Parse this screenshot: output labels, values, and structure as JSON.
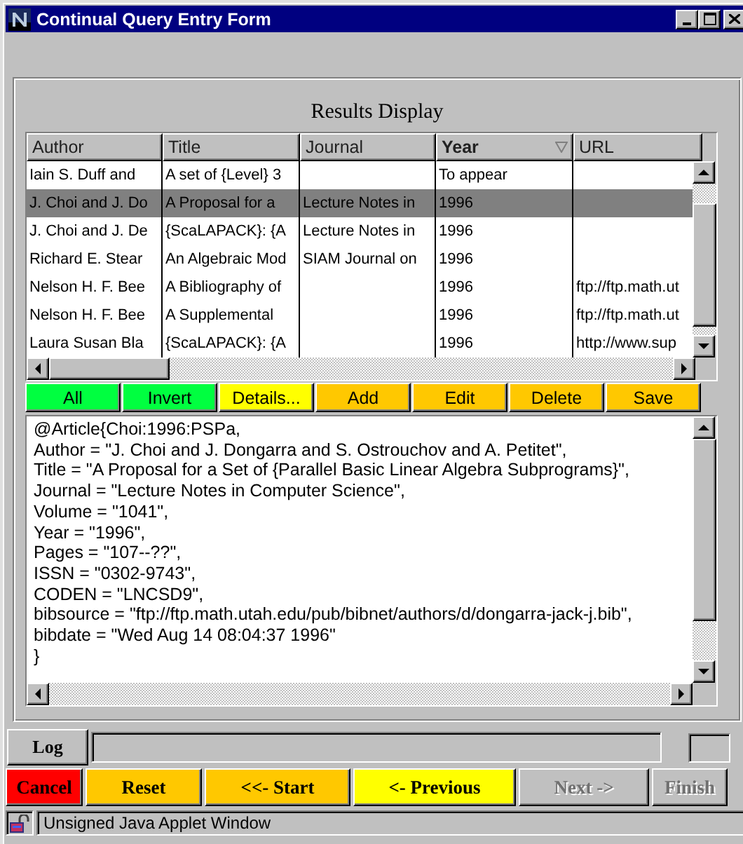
{
  "window": {
    "title": "Continual Query Entry Form"
  },
  "results": {
    "title": "Results Display",
    "columns": [
      {
        "label": "Author",
        "sorted": false
      },
      {
        "label": "Title",
        "sorted": false
      },
      {
        "label": "Journal",
        "sorted": false
      },
      {
        "label": "Year",
        "sorted": true
      },
      {
        "label": "URL",
        "sorted": false
      }
    ],
    "rows": [
      {
        "selected": false,
        "author": "Iain S. Duff and",
        "title": "A set of {Level} 3",
        "year": "To appear"
      },
      {
        "selected": true,
        "author": "J. Choi and J. Do",
        "title": "A Proposal for a",
        "journal": "Lecture Notes in",
        "year": "1996"
      },
      {
        "selected": false,
        "author": "J. Choi and J. De",
        "title": "{ScaLAPACK}: {A",
        "journal": "Lecture Notes in",
        "year": "1996"
      },
      {
        "selected": false,
        "author": "Richard E. Stear",
        "title": "An Algebraic Mod",
        "journal": "SIAM Journal on",
        "year": "1996"
      },
      {
        "selected": false,
        "author": "Nelson H. F. Bee",
        "title": "A Bibliography of",
        "year": "1996",
        "url": "ftp://ftp.math.ut"
      },
      {
        "selected": false,
        "author": "Nelson H. F. Bee",
        "title": "A Supplemental",
        "year": "1996",
        "url": "ftp://ftp.math.ut"
      },
      {
        "selected": false,
        "author": "Laura Susan Bla",
        "title": "{ScaLAPACK}: {A",
        "year": "1996",
        "url": "http://www.sup"
      }
    ],
    "buttons": [
      {
        "label": "All",
        "color": "#00ff40"
      },
      {
        "label": "Invert",
        "color": "#00ff40"
      },
      {
        "label": "Details...",
        "color": "#ffff00"
      },
      {
        "label": "Add",
        "color": "#ffc800"
      },
      {
        "label": "Edit",
        "color": "#ffc800"
      },
      {
        "label": "Delete",
        "color": "#ffc800"
      },
      {
        "label": "Save",
        "color": "#ffc800"
      }
    ],
    "details": [
      "@Article{Choi:1996:PSPa,",
      "Author = \"J. Choi and J. Dongarra and S. Ostrouchov and A. Petitet\",",
      "Title = \"A Proposal for a Set of {Parallel Basic Linear Algebra Subprograms}\",",
      "Journal = \"Lecture Notes in Computer Science\",",
      "Volume = \"1041\",",
      "Year = \"1996\",",
      "Pages = \"107--??\",",
      "ISSN = \"0302-9743\",",
      "CODEN = \"LNCSD9\",",
      "bibsource = \"ftp://ftp.math.utah.edu/pub/bibnet/authors/d/dongarra-jack-j.bib\",",
      "bibdate = \"Wed Aug 14 08:04:37 1996\"",
      "}"
    ]
  },
  "log": {
    "label": "Log"
  },
  "navigation": [
    {
      "label": "Cancel",
      "color": "#ff0000",
      "disabled": false
    },
    {
      "label": "Reset",
      "color": "#ffc800",
      "disabled": false
    },
    {
      "label": "<<- Start",
      "color": "#ffc800",
      "disabled": false
    },
    {
      "label": "<- Previous",
      "color": "#ffff00",
      "disabled": false
    },
    {
      "label": "Next ->",
      "color": "#c0c0c0",
      "disabled": true
    },
    {
      "label": "Finish",
      "color": "#c0c0c0",
      "disabled": true
    }
  ],
  "status_bar": {
    "text": "Unsigned Java Applet Window"
  }
}
